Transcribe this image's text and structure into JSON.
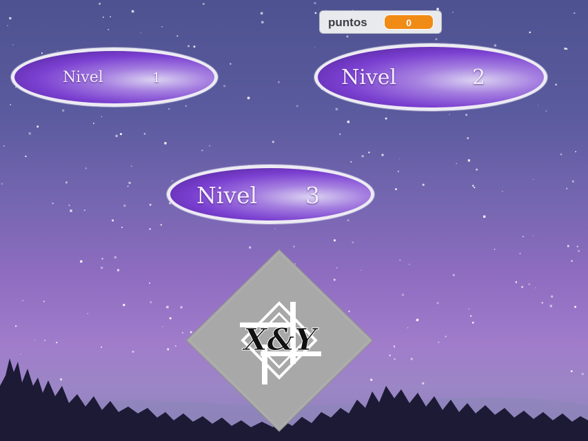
{
  "score": {
    "label": "puntos",
    "value": "0"
  },
  "levels": [
    {
      "word": "Nivel",
      "number": "1"
    },
    {
      "word": "Nivel",
      "number": "2"
    },
    {
      "word": "Nivel",
      "number": "3"
    }
  ],
  "logo": {
    "text": "X&Y"
  },
  "colors": {
    "score_accent": "#f08b16",
    "button_purple": "#7a3fd0",
    "button_border": "#ecebf3",
    "logo_gray": "#a8a8a8"
  }
}
